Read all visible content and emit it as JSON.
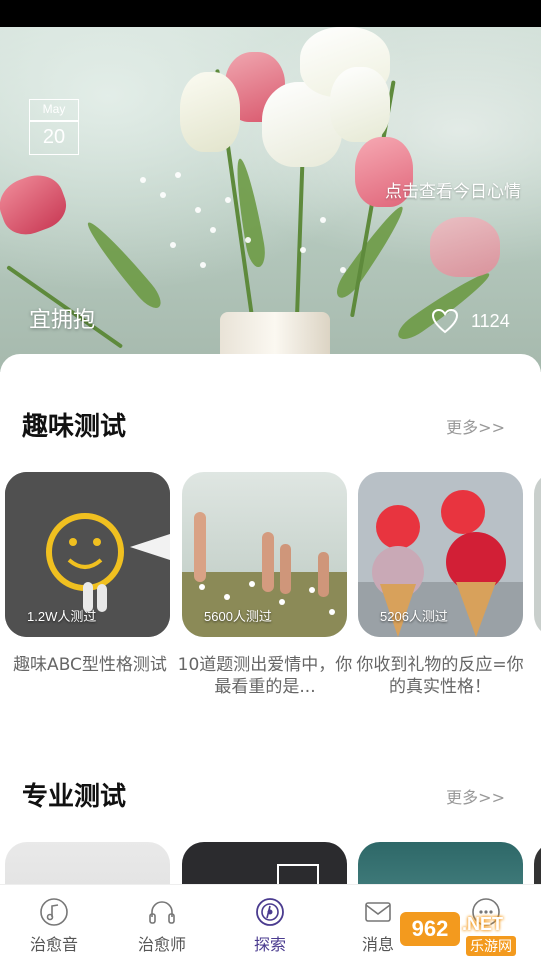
{
  "hero": {
    "date_month": "May",
    "date_day": "20",
    "link_text": "点击查看今日心情",
    "title": "宜拥抱",
    "like_count": "1124"
  },
  "sections": [
    {
      "title": "趣味测试",
      "more": "更多>>",
      "cards": [
        {
          "count": "1.2W人测过",
          "caption": "趣味ABC型性格测试"
        },
        {
          "count": "5600人测过",
          "caption": "10道题测出爱情中，你最看重的是..."
        },
        {
          "count": "5206人测过",
          "caption": "你收到礼物的反应=你的真实性格！"
        }
      ]
    },
    {
      "title": "专业测试",
      "more": "更多>>"
    }
  ],
  "tabs": [
    {
      "label": "治愈音",
      "icon": "music-note-icon"
    },
    {
      "label": "治愈师",
      "icon": "headphones-icon"
    },
    {
      "label": "探索",
      "icon": "compass-icon",
      "active": true
    },
    {
      "label": "消息",
      "icon": "mail-icon"
    },
    {
      "label": "",
      "icon": "chat-icon"
    }
  ],
  "watermark": {
    "brand": "962.NET",
    "sub": "乐游网"
  },
  "colors": {
    "accent": "#4a3b8f",
    "muted_text": "#666666",
    "more_text": "#999999"
  }
}
